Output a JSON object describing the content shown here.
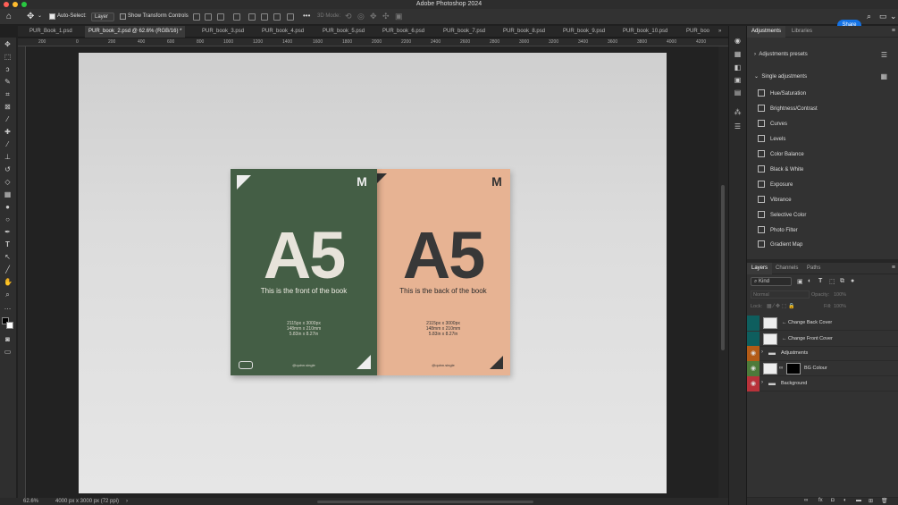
{
  "window": {
    "title": "Adobe Photoshop 2024"
  },
  "options_bar": {
    "auto_select_label": "Auto-Select:",
    "auto_select_value": "Layer",
    "transform_controls_label": "Show Transform Controls",
    "mode_3d_label": "3D Mode:",
    "share_label": "Share"
  },
  "tabs": [
    {
      "label": "PUR_Book_1.psd"
    },
    {
      "label": "PUR_book_2.psd @ 62.6% (RGB/16) *"
    },
    {
      "label": "PUR_book_3.psd"
    },
    {
      "label": "PUR_book_4.psd"
    },
    {
      "label": "PUR_book_5.psd"
    },
    {
      "label": "PUR_book_6.psd"
    },
    {
      "label": "PUR_book_7.psd"
    },
    {
      "label": "PUR_book_8.psd"
    },
    {
      "label": "PUR_book_9.psd"
    },
    {
      "label": "PUR_book_10.psd"
    },
    {
      "label": "PUR_boo"
    }
  ],
  "ruler_ticks": [
    "200",
    "0",
    "200",
    "400",
    "600",
    "800",
    "1000",
    "1200",
    "1400",
    "1600",
    "1800",
    "2000",
    "2200",
    "2400",
    "2600",
    "2800",
    "3000",
    "3200",
    "3400",
    "3600",
    "3800",
    "4000",
    "4200"
  ],
  "canvas": {
    "front_book": {
      "big_text": "A5",
      "subtitle": "This is the front of the book",
      "dims": [
        "2115px x 3000px",
        "148mm x 210mm",
        "5.83in x 8.27in"
      ],
      "handle": "@quinn.single",
      "color": "#445e45"
    },
    "back_book": {
      "big_text": "A5",
      "subtitle": "This is the back of the book",
      "dims": [
        "2115px x 3000px",
        "148mm x 210mm",
        "5.83in x 8.27in"
      ],
      "handle": "@quinn.single",
      "color": "#e7b393"
    }
  },
  "status": {
    "zoom": "62.6%",
    "doc_info": "4000 px x 3000 px (72 ppi)"
  },
  "adjustments_panel": {
    "tabs": [
      "Adjustments",
      "Libraries"
    ],
    "presets_label": "Adjustments presets",
    "single_label": "Single adjustments",
    "items": [
      "Hue/Saturation",
      "Brightness/Contrast",
      "Curves",
      "Levels",
      "Color Balance",
      "Black & White",
      "Exposure",
      "Vibrance",
      "Selective Color",
      "Photo Filter",
      "Gradient Map"
    ]
  },
  "layers_panel": {
    "tabs": [
      "Layers",
      "Channels",
      "Paths"
    ],
    "filter_kind": "Kind",
    "blend_mode": "Normal",
    "opacity_label": "Opacity:",
    "opacity_value": "100%",
    "lock_label": "Lock:",
    "fill_label": "Fill:",
    "fill_value": "100%",
    "layers": [
      {
        "name": "← Change Back Cover",
        "color": "#0e5e5e"
      },
      {
        "name": "← Change Front Cover",
        "color": "#0e5e5e"
      },
      {
        "name": "Adjustments",
        "color": "#b35b16"
      },
      {
        "name": "BG Colour",
        "color": "#4d7a3a"
      },
      {
        "name": "Background",
        "color": "#b8323a"
      }
    ]
  }
}
